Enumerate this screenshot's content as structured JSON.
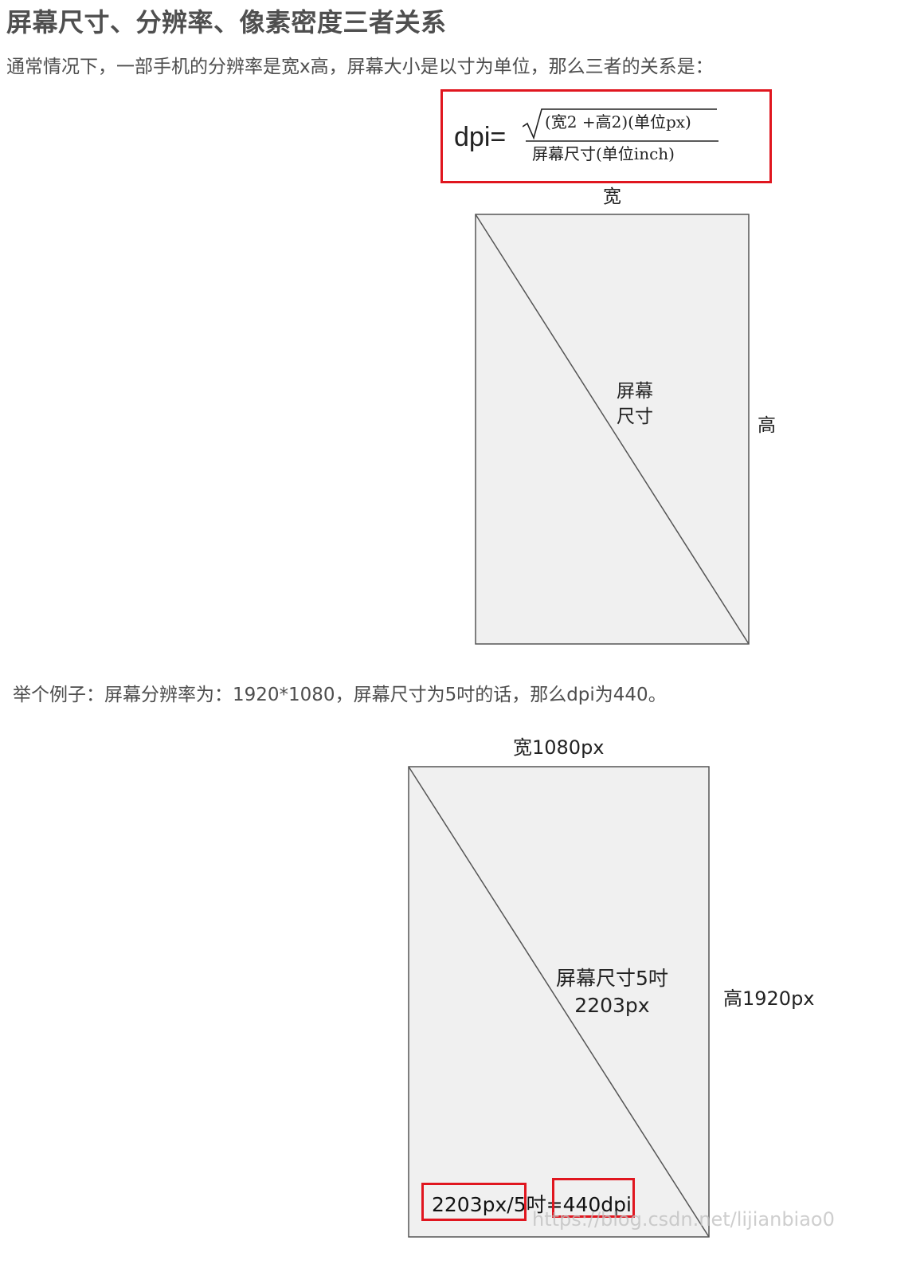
{
  "heading": "屏幕尺寸、分辨率、像素密度三者关系",
  "intro": "通常情况下，一部手机的分辨率是宽x高，屏幕大小是以寸为单位，那么三者的关系是：",
  "formula": {
    "lhs": "dpi=",
    "numerator": "(宽2 +高2)(单位px)",
    "denominator": "屏幕尺寸(单位inch)"
  },
  "diagram1": {
    "width_label": "宽",
    "height_label": "高",
    "center_line1": "屏幕",
    "center_line2": "尺寸"
  },
  "example": "举个例子：屏幕分辨率为：1920*1080，屏幕尺寸为5吋的话，那么dpi为440。",
  "diagram2": {
    "width_label": "宽1080px",
    "height_label": "高1920px",
    "center_line1": "屏幕尺寸5吋",
    "center_line2": "2203px",
    "calc_part1": "2203px/5",
    "calc_part2": "吋=",
    "calc_part3": "440dpi"
  },
  "watermark": "https://blog.csdn.net/lijianbiao0",
  "colors": {
    "highlight": "#e0161f",
    "screen_fill": "#f0f0f0",
    "screen_stroke": "#555555"
  }
}
